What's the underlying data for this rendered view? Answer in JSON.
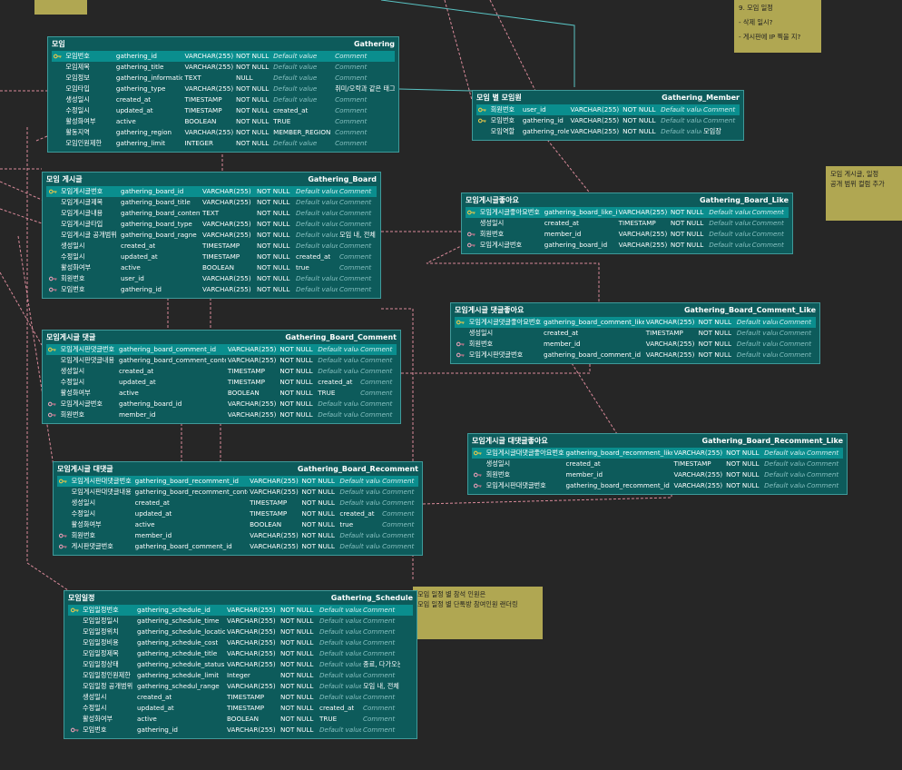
{
  "notes": [
    {
      "id": "note-schedule",
      "lines": [
        "9. 모임 일정",
        "- 삭제 일시?",
        "- 게시판에 IP 찍을 지?"
      ]
    },
    {
      "id": "note-board",
      "lines": [
        "모임 게시글, 일정",
        "공개 범위 컬럼 추가"
      ]
    },
    {
      "id": "note-attend",
      "lines": [
        "모임 일정 별 참석 인원은",
        "모임 일정 별 단톡방 참여인원 랜더링"
      ]
    }
  ],
  "tables": [
    {
      "id": "gathering",
      "title": "모임",
      "name": "Gathering",
      "columns": [
        {
          "label": "모임번호",
          "name": "gathering_id",
          "type": "VARCHAR(255)",
          "null": "NOT NULL",
          "default": "Default value",
          "comment": "Comment",
          "key": "pk"
        },
        {
          "label": "모임제목",
          "name": "gathering_title",
          "type": "VARCHAR(255)",
          "null": "NOT NULL",
          "default": "Default value",
          "comment": "Comment"
        },
        {
          "label": "모임정보",
          "name": "gathering_information",
          "type": "TEXT",
          "null": "NULL",
          "default": "Default value",
          "comment": "Comment"
        },
        {
          "label": "모임타입",
          "name": "gathering_type",
          "type": "VARCHAR(255)",
          "null": "NOT NULL",
          "default": "Default value",
          "comment": "취미/오락과 같은 태그",
          "commentIsValue": true
        },
        {
          "label": "생성일시",
          "name": "created_at",
          "type": "TIMESTAMP",
          "null": "NOT NULL",
          "default": "Default value",
          "comment": "Comment"
        },
        {
          "label": "수정일시",
          "name": "updated_at",
          "type": "TIMESTAMP",
          "null": "NOT NULL",
          "default": "created_at",
          "defaultIsValue": true,
          "comment": "Comment"
        },
        {
          "label": "활성화여부",
          "name": "active",
          "type": "BOOLEAN",
          "null": "NOT NULL",
          "default": "TRUE",
          "defaultIsValue": true,
          "comment": "Comment"
        },
        {
          "label": "활동지역",
          "name": "gathering_region",
          "type": "VARCHAR(255)",
          "null": "NOT NULL",
          "default": "MEMBER_REGION",
          "defaultIsValue": true,
          "comment": "Comment"
        },
        {
          "label": "모임인원제한",
          "name": "gathering_limit",
          "type": "INTEGER",
          "null": "NOT NULL",
          "default": "Default value",
          "comment": "Comment"
        }
      ]
    },
    {
      "id": "gathering-member",
      "title": "모임 별 모임원",
      "name": "Gathering_Member",
      "columns": [
        {
          "label": "회원번호",
          "name": "user_id",
          "type": "VARCHAR(255)",
          "null": "NOT NULL",
          "default": "Default value",
          "comment": "Comment",
          "key": "pk"
        },
        {
          "label": "모임번호",
          "name": "gathering_id",
          "type": "VARCHAR(255)",
          "null": "NOT NULL",
          "default": "Default value",
          "comment": "Comment",
          "key": "pk"
        },
        {
          "label": "모임역할",
          "name": "gathering_role",
          "type": "VARCHAR(255)",
          "null": "NOT NULL",
          "default": "Default value",
          "comment": "모임장",
          "commentIsValue": true
        }
      ]
    },
    {
      "id": "gathering-board",
      "title": "모임 게시글",
      "name": "Gathering_Board",
      "columns": [
        {
          "label": "모임게시글번호",
          "name": "gathering_board_id",
          "type": "VARCHAR(255)",
          "null": "NOT NULL",
          "default": "Default value",
          "comment": "Comment",
          "key": "pk"
        },
        {
          "label": "모임게시글제목",
          "name": "gathering_board_title",
          "type": "VARCHAR(255)",
          "null": "NOT NULL",
          "default": "Default value",
          "comment": "Comment"
        },
        {
          "label": "모임게시글내용",
          "name": "gathering_board_contents",
          "type": "TEXT",
          "null": "NOT NULL",
          "default": "Default value",
          "comment": "Comment"
        },
        {
          "label": "모임게시글타입",
          "name": "gathering_board_type",
          "type": "VARCHAR(255)",
          "null": "NOT NULL",
          "default": "Default value",
          "comment": "Comment"
        },
        {
          "label": "모임게시글 공개범위",
          "name": "gathering_board_ragne",
          "type": "VARCHAR(255)",
          "null": "NOT NULL",
          "default": "Default value",
          "comment": "모임 내, 전체",
          "commentIsValue": true
        },
        {
          "label": "생성일시",
          "name": "created_at",
          "type": "TIMESTAMP",
          "null": "NOT NULL",
          "default": "Default value",
          "comment": "Comment"
        },
        {
          "label": "수정일시",
          "name": "updated_at",
          "type": "TIMESTAMP",
          "null": "NOT NULL",
          "default": "created_at",
          "defaultIsValue": true,
          "comment": "Comment"
        },
        {
          "label": "활성화여부",
          "name": "active",
          "type": "BOOLEAN",
          "null": "NOT NULL",
          "default": "true",
          "defaultIsValue": true,
          "comment": "Comment"
        },
        {
          "label": "회원번호",
          "name": "user_id",
          "type": "VARCHAR(255)",
          "null": "NOT NULL",
          "default": "Default value",
          "comment": "Comment",
          "key": "fk"
        },
        {
          "label": "모임번호",
          "name": "gathering_id",
          "type": "VARCHAR(255)",
          "null": "NOT NULL",
          "default": "Default value",
          "comment": "Comment",
          "key": "fk"
        }
      ]
    },
    {
      "id": "gathering-board-like",
      "title": "모임게시글좋아요",
      "name": "Gathering_Board_Like",
      "columns": [
        {
          "label": "모임게시글좋아요번호",
          "name": "gathering_board_like_id",
          "type": "VARCHAR(255)",
          "null": "NOT NULL",
          "default": "Default value",
          "comment": "Comment",
          "key": "pk"
        },
        {
          "label": "생성일시",
          "name": "created_at",
          "type": "TIMESTAMP",
          "null": "NOT NULL",
          "default": "Default value",
          "comment": "Comment"
        },
        {
          "label": "회원번호",
          "name": "member_id",
          "type": "VARCHAR(255)",
          "null": "NOT NULL",
          "default": "Default value",
          "comment": "Comment",
          "key": "fk"
        },
        {
          "label": "모임게시글번호",
          "name": "gathering_board_id",
          "type": "VARCHAR(255)",
          "null": "NOT NULL",
          "default": "Default value",
          "comment": "Comment",
          "key": "fk"
        }
      ]
    },
    {
      "id": "gathering-board-comment-like",
      "title": "모임게시글 댓글좋아요",
      "name": "Gathering_Board_Comment_Like",
      "columns": [
        {
          "label": "모임게시글댓글좋아요번호",
          "name": "gathering_board_comment_like_id",
          "type": "VARCHAR(255)",
          "null": "NOT NULL",
          "default": "Default value",
          "comment": "Comment",
          "key": "pk"
        },
        {
          "label": "생성일시",
          "name": "created_at",
          "type": "TIMESTAMP",
          "null": "NOT NULL",
          "default": "Default value",
          "comment": "Comment"
        },
        {
          "label": "회원번호",
          "name": "member_id",
          "type": "VARCHAR(255)",
          "null": "NOT NULL",
          "default": "Default value",
          "comment": "Comment",
          "key": "fk"
        },
        {
          "label": "모임게시판댓글번호",
          "name": "gathering_board_comment_id",
          "type": "VARCHAR(255)",
          "null": "NOT NULL",
          "default": "Default value",
          "comment": "Comment",
          "key": "fk"
        }
      ]
    },
    {
      "id": "gathering-board-comment",
      "title": "모임게시글 댓글",
      "name": "Gathering_Board_Comment",
      "columns": [
        {
          "label": "모임게시판댓글번호",
          "name": "gathering_board_comment_id",
          "type": "VARCHAR(255)",
          "null": "NOT NULL",
          "default": "Default value",
          "comment": "Comment",
          "key": "pk"
        },
        {
          "label": "모임게시판댓글내용",
          "name": "gathering_board_comment_contents",
          "type": "VARCHAR(255)",
          "null": "NOT NULL",
          "default": "Default value",
          "comment": "Comment"
        },
        {
          "label": "생성일시",
          "name": "created_at",
          "type": "TIMESTAMP",
          "null": "NOT NULL",
          "default": "Default value",
          "comment": "Comment"
        },
        {
          "label": "수정일시",
          "name": "updated_at",
          "type": "TIMESTAMP",
          "null": "NOT NULL",
          "default": "created_at",
          "defaultIsValue": true,
          "comment": "Comment"
        },
        {
          "label": "활성화여부",
          "name": "active",
          "type": "BOOLEAN",
          "null": "NOT NULL",
          "default": "TRUE",
          "defaultIsValue": true,
          "comment": "Comment"
        },
        {
          "label": "모임게시글번호",
          "name": "gathering_board_id",
          "type": "VARCHAR(255)",
          "null": "NOT NULL",
          "default": "Default value",
          "comment": "Comment",
          "key": "fk"
        },
        {
          "label": "회원번호",
          "name": "member_id",
          "type": "VARCHAR(255)",
          "null": "NOT NULL",
          "default": "Default value",
          "comment": "Comment",
          "key": "fk"
        }
      ]
    },
    {
      "id": "gathering-board-recomment-like",
      "title": "모임게시글 대댓글좋아요",
      "name": "Gathering_Board_Recomment_Like",
      "columns": [
        {
          "label": "모임게시글대댓글좋아요번호",
          "name": "gathering_board_recomment_like_id",
          "type": "VARCHAR(255)",
          "null": "NOT NULL",
          "default": "Default value",
          "comment": "Comment",
          "key": "pk"
        },
        {
          "label": "생성일시",
          "name": "created_at",
          "type": "TIMESTAMP",
          "null": "NOT NULL",
          "default": "Default value",
          "comment": "Comment"
        },
        {
          "label": "회원번호",
          "name": "member_id",
          "type": "VARCHAR(255)",
          "null": "NOT NULL",
          "default": "Default value",
          "comment": "Comment",
          "key": "fk"
        },
        {
          "label": "모임게시판대댓글번호",
          "name": "gathering_board_recomment_id",
          "type": "VARCHAR(255)",
          "null": "NOT NULL",
          "default": "Default value",
          "comment": "Comment",
          "key": "fk"
        }
      ]
    },
    {
      "id": "gathering-board-recomment",
      "title": "모임게시글 대댓글",
      "name": "Gathering_Board_Recomment",
      "columns": [
        {
          "label": "모임게시판대댓글번호",
          "name": "gathering_board_recomment_id",
          "type": "VARCHAR(255)",
          "null": "NOT NULL",
          "default": "Default value",
          "comment": "Comment",
          "key": "pk"
        },
        {
          "label": "모임게시판대댓글내용",
          "name": "gathering_board_recomment_contents",
          "type": "VARCHAR(255)",
          "null": "NOT NULL",
          "default": "Default value",
          "comment": "Comment"
        },
        {
          "label": "생성일시",
          "name": "created_at",
          "type": "TIMESTAMP",
          "null": "NOT NULL",
          "default": "Default value",
          "comment": "Comment"
        },
        {
          "label": "수정일시",
          "name": "updated_at",
          "type": "TIMESTAMP",
          "null": "NOT NULL",
          "default": "created_at",
          "defaultIsValue": true,
          "comment": "Comment"
        },
        {
          "label": "활성화여부",
          "name": "active",
          "type": "BOOLEAN",
          "null": "NOT NULL",
          "default": "true",
          "defaultIsValue": true,
          "comment": "Comment"
        },
        {
          "label": "회원번호",
          "name": "member_id",
          "type": "VARCHAR(255)",
          "null": "NOT NULL",
          "default": "Default value",
          "comment": "Comment",
          "key": "fk"
        },
        {
          "label": "게시판댓글번호",
          "name": "gathering_board_comment_id",
          "type": "VARCHAR(255)",
          "null": "NOT NULL",
          "default": "Default value",
          "comment": "Comment",
          "key": "fk"
        }
      ]
    },
    {
      "id": "gathering-schedule",
      "title": "모임일정",
      "name": "Gathering_Schedule",
      "columns": [
        {
          "label": "모임일정번호",
          "name": "gathering_schedule_id",
          "type": "VARCHAR(255)",
          "null": "NOT NULL",
          "default": "Default value",
          "comment": "Comment",
          "key": "pk"
        },
        {
          "label": "모임일정일시",
          "name": "gathering_schedule_time",
          "type": "VARCHAR(255)",
          "null": "NOT NULL",
          "default": "Default value",
          "comment": "Comment"
        },
        {
          "label": "모임일정위치",
          "name": "gathering_schedule_location",
          "type": "VARCHAR(255)",
          "null": "NOT NULL",
          "default": "Default value",
          "comment": "Comment"
        },
        {
          "label": "모임일정비용",
          "name": "gathering_schedule_cost",
          "type": "VARCHAR(255)",
          "null": "NOT NULL",
          "default": "Default value",
          "comment": "Comment"
        },
        {
          "label": "모임일정제목",
          "name": "gathering_schedule_title",
          "type": "VARCHAR(255)",
          "null": "NOT NULL",
          "default": "Default value",
          "comment": "Comment"
        },
        {
          "label": "모임일정상태",
          "name": "gathering_schedule_status",
          "type": "VARCHAR(255)",
          "null": "NOT NULL",
          "default": "Default value",
          "comment": "종료, 다가오는 등",
          "commentIsValue": true
        },
        {
          "label": "모임일정인원제한",
          "name": "gathering_schedule_limit",
          "type": "Integer",
          "null": "NOT NULL",
          "default": "Default value",
          "comment": "Comment"
        },
        {
          "label": "모임일정 공개범위",
          "name": "gathering_schedul_range",
          "type": "VARCHAR(255)",
          "null": "NOT NULL",
          "default": "Default value",
          "comment": "모임 내, 전체",
          "commentIsValue": true
        },
        {
          "label": "생성일시",
          "name": "created_at",
          "type": "TIMESTAMP",
          "null": "NOT NULL",
          "default": "Default value",
          "comment": "Comment"
        },
        {
          "label": "수정일시",
          "name": "updated_at",
          "type": "TIMESTAMP",
          "null": "NOT NULL",
          "default": "created_at",
          "defaultIsValue": true,
          "comment": "Comment"
        },
        {
          "label": "활성화여부",
          "name": "active",
          "type": "BOOLEAN",
          "null": "NOT NULL",
          "default": "TRUE",
          "defaultIsValue": true,
          "comment": "Comment"
        },
        {
          "label": "모임번호",
          "name": "gathering_id",
          "type": "VARCHAR(255)",
          "null": "NOT NULL",
          "default": "Default value",
          "comment": "Comment",
          "key": "fk"
        }
      ]
    }
  ]
}
